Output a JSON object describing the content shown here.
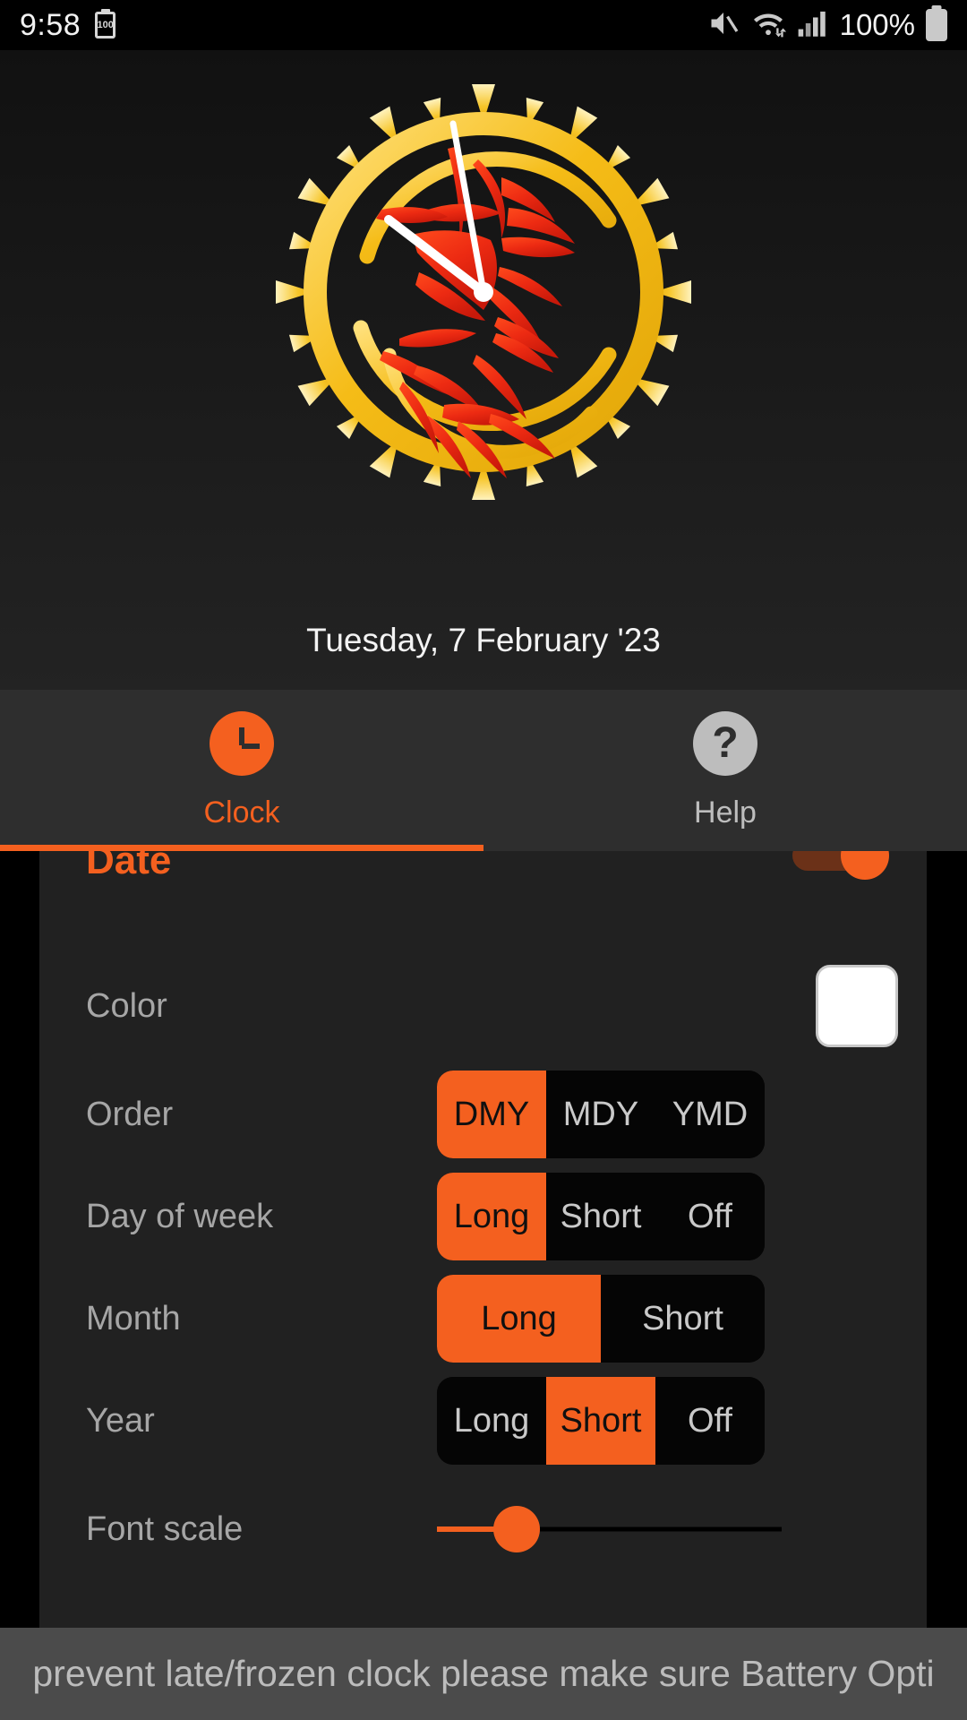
{
  "status_bar": {
    "time": "9:58",
    "battery_badge": "100",
    "battery_percent": "100%",
    "icons": [
      "battery-saver-icon",
      "mute-icon",
      "wifi-icon",
      "signal-icon",
      "battery-icon"
    ]
  },
  "clock": {
    "date_text": "Tuesday, 7 February '23",
    "hour_hand_angle": -52,
    "minute_hand_angle": -8,
    "ring_color": "#f2b712",
    "art_color": "#ee2f18",
    "hand_color": "#ffffff"
  },
  "tabs": [
    {
      "label": "Clock",
      "icon": "clock-icon",
      "active": true
    },
    {
      "label": "Help",
      "icon": "question-mark-icon",
      "active": false
    }
  ],
  "settings": {
    "section_title": "Date",
    "master_switch_on": true,
    "accent_color": "#f4601f",
    "rows": [
      {
        "name": "color",
        "label": "Color",
        "type": "swatch",
        "value": "#ffffff"
      },
      {
        "name": "order",
        "label": "Order",
        "type": "segmented",
        "options": [
          "DMY",
          "MDY",
          "YMD"
        ],
        "selected": "DMY",
        "widths": [
          122,
          172,
          172
        ]
      },
      {
        "name": "day-of-week",
        "label": "Day of week",
        "type": "segmented",
        "options": [
          "Long",
          "Short",
          "Off"
        ],
        "selected": "Long",
        "widths": [
          122,
          172,
          172
        ]
      },
      {
        "name": "month",
        "label": "Month",
        "type": "segmented",
        "options": [
          "Long",
          "Short"
        ],
        "selected": "Long",
        "widths": [
          184,
          182
        ]
      },
      {
        "name": "year",
        "label": "Year",
        "type": "segmented",
        "options": [
          "Long",
          "Short",
          "Off"
        ],
        "selected": "Short",
        "widths": [
          122,
          122,
          122
        ]
      },
      {
        "name": "font-scale",
        "label": "Font scale",
        "type": "slider",
        "value_percent": 23
      }
    ]
  },
  "toast": {
    "text": "prevent late/frozen clock please make sure Battery Opti"
  }
}
